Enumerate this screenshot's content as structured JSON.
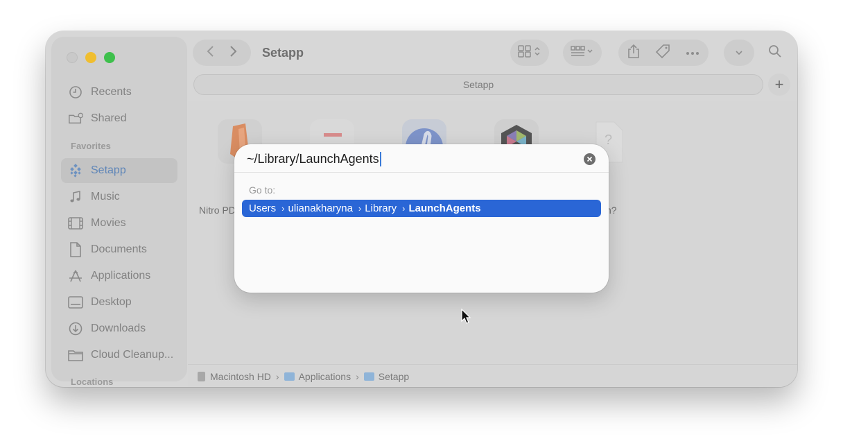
{
  "window": {
    "title": "Setapp"
  },
  "toolbar": {
    "back_icon": "chevron-left-icon",
    "forward_icon": "chevron-right-icon",
    "view_icon": "grid-view-icon",
    "group_icon": "group-icon",
    "share_icon": "share-icon",
    "tag_icon": "tag-icon",
    "more_icon": "ellipsis-icon",
    "dropdown_icon": "chevron-down-icon",
    "search_icon": "search-icon"
  },
  "pathbar": {
    "label": "Setapp",
    "add_label": "+"
  },
  "sidebar": {
    "items_top": [
      {
        "label": "Recents",
        "icon": "clock-icon"
      },
      {
        "label": "Shared",
        "icon": "shared-folder-icon"
      }
    ],
    "favorites_heading": "Favorites",
    "favorites": [
      {
        "label": "Setapp",
        "icon": "setapp-icon",
        "active": true
      },
      {
        "label": "Music",
        "icon": "music-note-icon"
      },
      {
        "label": "Movies",
        "icon": "film-icon"
      },
      {
        "label": "Documents",
        "icon": "document-icon"
      },
      {
        "label": "Applications",
        "icon": "applications-icon"
      },
      {
        "label": "Desktop",
        "icon": "desktop-icon"
      },
      {
        "label": "Downloads",
        "icon": "download-icon"
      },
      {
        "label": "Cloud Cleanup...",
        "icon": "folder-icon"
      }
    ],
    "locations_heading": "Locations"
  },
  "files": [
    {
      "label": "Nitro PD",
      "icon": "nitro-pdf-app-icon",
      "color": "#e56b3a"
    },
    {
      "label": "",
      "icon": "app-icon",
      "color": "#e6e6e6"
    },
    {
      "label": "",
      "icon": "app-icon",
      "color": "#4d6fd6"
    },
    {
      "label": "",
      "icon": "app-icon",
      "color": "#3c3c3c"
    },
    {
      "label": "n?",
      "icon": "unknown-file-icon",
      "color": "#e4e4e4"
    }
  ],
  "statusbar": {
    "path": [
      "Macintosh HD",
      "Applications",
      "Setapp"
    ],
    "separator": "›"
  },
  "goto_dialog": {
    "input_value": "~/Library/LaunchAgents",
    "clear_icon": "clear-circle-icon",
    "goto_label": "Go to:",
    "suggestion": [
      "Users",
      "ulianakharyna",
      "Library",
      "LaunchAgents"
    ],
    "separator": "›",
    "highlight_color": "#2a66d6"
  },
  "colors": {
    "accent": "#2a66d6",
    "traffic_min": "#f0be2f",
    "traffic_max": "#3ec04c"
  }
}
